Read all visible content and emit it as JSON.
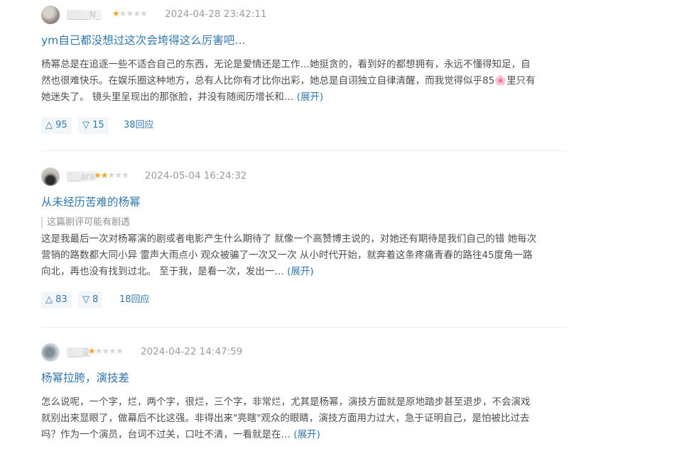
{
  "reviews": [
    {
      "username": "_____N_",
      "stars_filled": 1,
      "stars_total": 5,
      "date": "2024-04-28 23:42:11",
      "title": "ym自己都没想过这次会垮得这么厉害吧…",
      "spoiler": "",
      "body_lines": [
        "杨幂总是在追逐一些不适合自己的东西，无论是爱情还是工作…她挺贪的，看到好的都想拥有，永远不懂得知足，自",
        "然也很难快乐。在娱乐圈这种地方，总有人比你有才比你出彩，她总是自诩独立自律清醒，而我觉得似乎85🌸里只有",
        "她迷失了。 镜头里呈现出的那张脸，并没有随阅历增长和…"
      ],
      "expand": "(展开)",
      "upvotes": "95",
      "downvotes": "15",
      "replies": "38回应"
    },
    {
      "username": "___ara",
      "stars_filled": 2,
      "stars_total": 5,
      "date": "2024-05-04 16:24:32",
      "title": "从未经历苦难的杨幂",
      "spoiler": "这篇剧评可能有剧透",
      "body_lines": [
        "这是我最后一次对杨幂演的剧或者电影产生什么期待了 就像一个高赞博主说的，对她还有期待是我们自己的错 她每次",
        "营销的路数都大同小异 雷声大雨点小 观众被骗了一次又一次 从小时代开始，就奔着这条疼痛青春的路往45度角一路",
        "向北，再也没有找到过北。 至于我，是看一次，发出一…"
      ],
      "expand": "(展开)",
      "upvotes": "83",
      "downvotes": "8",
      "replies": "18回应"
    },
    {
      "username": "___没",
      "stars_filled": 1,
      "stars_total": 5,
      "date": "2024-04-22 14:47:59",
      "title": "杨幂拉胯，演技差",
      "spoiler": "",
      "body_lines": [
        "怎么说呢，一个字，烂，两个字，很烂，三个字，非常烂，尤其是杨幂，演技方面就是原地踏步甚至退步，不会演戏",
        "就别出来显眼了，做幕后不比这强。非得出来\"亮瞎\"观众的眼睛，演技方面用力过大，急于证明自己，是怕被比过去",
        "吗？作为一个演员，台词不过关，口吐不清，一看就是在…"
      ],
      "expand": "(展开)",
      "upvotes": "",
      "downvotes": "",
      "replies": ""
    }
  ],
  "icons": {
    "upvote": "△",
    "downvote": "▽",
    "star": "★"
  },
  "colors": {
    "link": "#3377aa",
    "star_on": "#f4a51c",
    "star_off": "#d6d6d6",
    "date": "#9b9b9b"
  }
}
